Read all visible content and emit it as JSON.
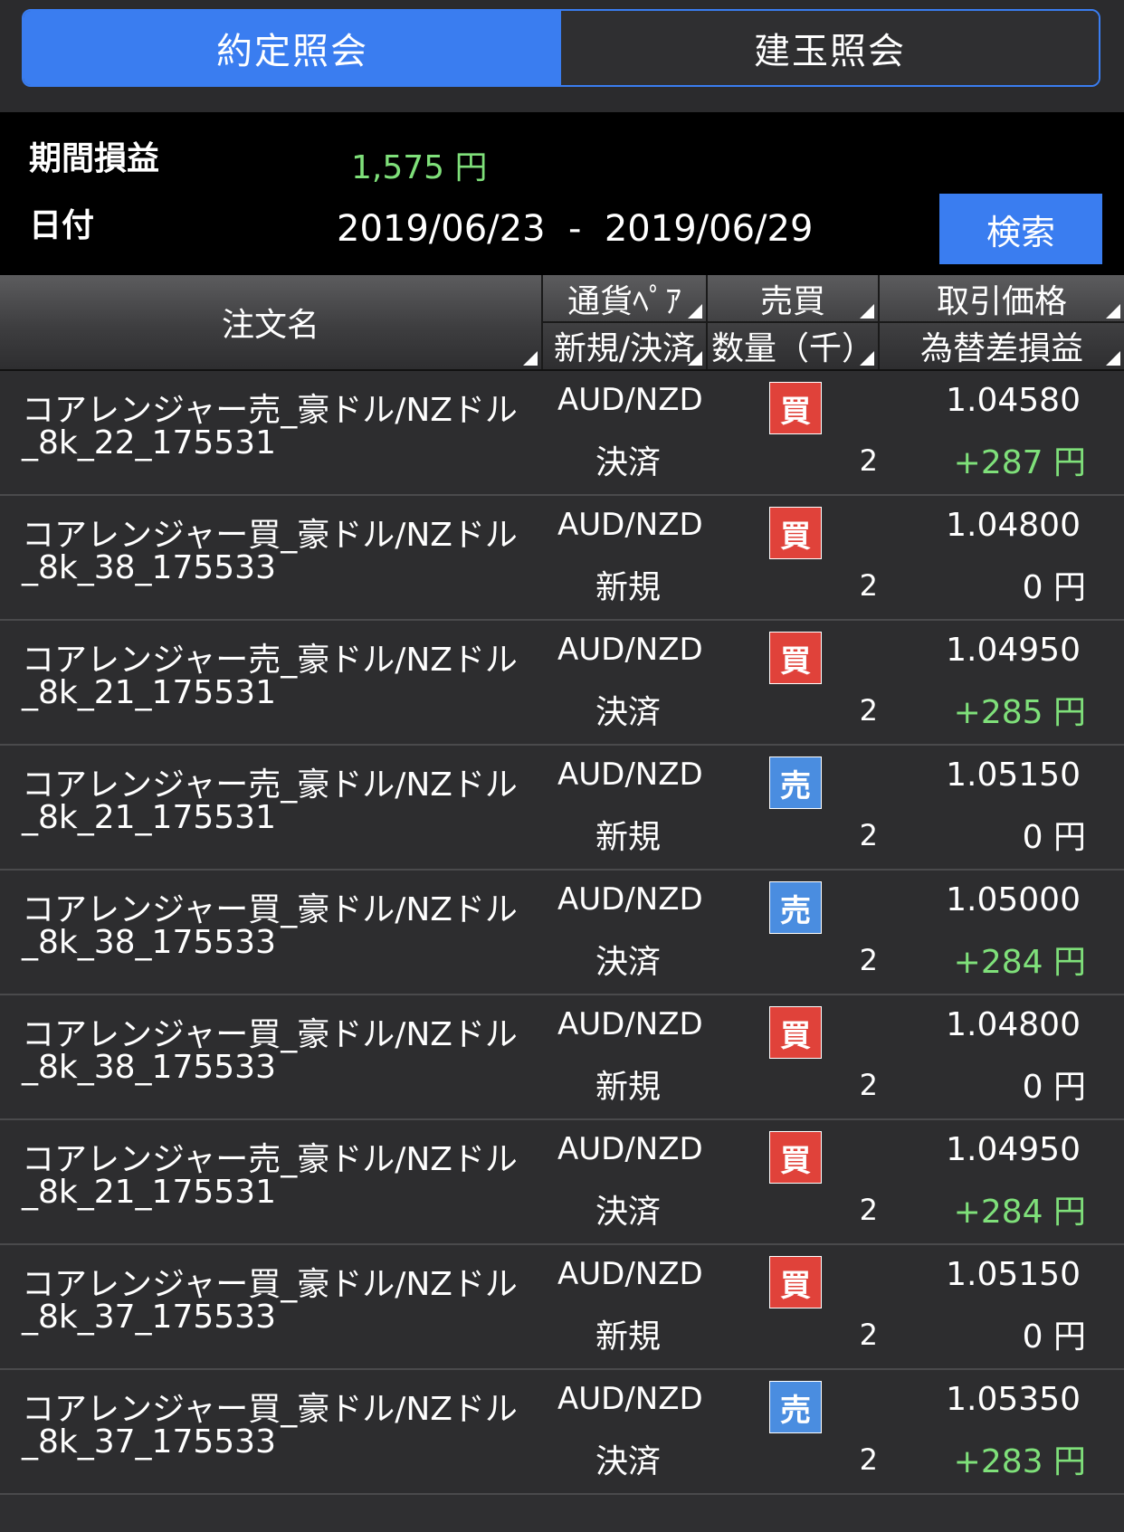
{
  "tabs": {
    "execution_inquiry": "約定照会",
    "position_inquiry": "建玉照会"
  },
  "summary": {
    "pl_label": "期間損益",
    "pl_value": "1,575 円",
    "date_label": "日付",
    "date_range": "2019/06/23  -  2019/06/29",
    "search_label": "検索"
  },
  "header": {
    "order_name": "注文名",
    "currency_pair": "通貨ﾍﾟｱ",
    "new_settle": "新規/決済",
    "buy_sell": "売買",
    "quantity": "数量（千）",
    "price": "取引価格",
    "fx_pnl": "為替差損益"
  },
  "rows": [
    {
      "name": "コアレンジャー売_豪ドル/NZドル_8k_22_175531",
      "pair": "AUD/NZD",
      "type": "決済",
      "side": "買",
      "qty": "2",
      "price": "1.04580",
      "pnl": "+287 円"
    },
    {
      "name": "コアレンジャー買_豪ドル/NZドル_8k_38_175533",
      "pair": "AUD/NZD",
      "type": "新規",
      "side": "買",
      "qty": "2",
      "price": "1.04800",
      "pnl": "0 円"
    },
    {
      "name": "コアレンジャー売_豪ドル/NZドル_8k_21_175531",
      "pair": "AUD/NZD",
      "type": "決済",
      "side": "買",
      "qty": "2",
      "price": "1.04950",
      "pnl": "+285 円"
    },
    {
      "name": "コアレンジャー売_豪ドル/NZドル_8k_21_175531",
      "pair": "AUD/NZD",
      "type": "新規",
      "side": "売",
      "qty": "2",
      "price": "1.05150",
      "pnl": "0 円"
    },
    {
      "name": "コアレンジャー買_豪ドル/NZドル_8k_38_175533",
      "pair": "AUD/NZD",
      "type": "決済",
      "side": "売",
      "qty": "2",
      "price": "1.05000",
      "pnl": "+284 円"
    },
    {
      "name": "コアレンジャー買_豪ドル/NZドル_8k_38_175533",
      "pair": "AUD/NZD",
      "type": "新規",
      "side": "買",
      "qty": "2",
      "price": "1.04800",
      "pnl": "0 円"
    },
    {
      "name": "コアレンジャー売_豪ドル/NZドル_8k_21_175531",
      "pair": "AUD/NZD",
      "type": "決済",
      "side": "買",
      "qty": "2",
      "price": "1.04950",
      "pnl": "+284 円"
    },
    {
      "name": "コアレンジャー買_豪ドル/NZドル_8k_37_175533",
      "pair": "AUD/NZD",
      "type": "新規",
      "side": "買",
      "qty": "2",
      "price": "1.05150",
      "pnl": "0 円"
    },
    {
      "name": "コアレンジャー買_豪ドル/NZドル_8k_37_175533",
      "pair": "AUD/NZD",
      "type": "決済",
      "side": "売",
      "qty": "2",
      "price": "1.05350",
      "pnl": "+283 円"
    }
  ],
  "colors": {
    "accent": "#3a7df0",
    "buy": "#e0423a",
    "sell": "#4a8de0",
    "profit": "#7fe07a"
  }
}
